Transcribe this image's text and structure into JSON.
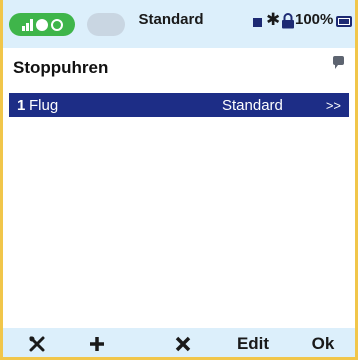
{
  "status": {
    "title": "Standard",
    "battery": "100%"
  },
  "page": {
    "title": "Stoppuhren"
  },
  "timers": [
    {
      "number": "1",
      "name": "Flug",
      "mode": "Standard",
      "more": ">>"
    }
  ],
  "footer": {
    "tools_icon": "tools-icon",
    "add_icon": "plus-icon",
    "delete_icon": "close-icon",
    "edit_label": "Edit",
    "ok_label": "Ok"
  },
  "colors": {
    "accent": "#1d2d86",
    "statusbar": "#dceffb",
    "border": "#f1c64a",
    "green": "#3fb54a"
  }
}
